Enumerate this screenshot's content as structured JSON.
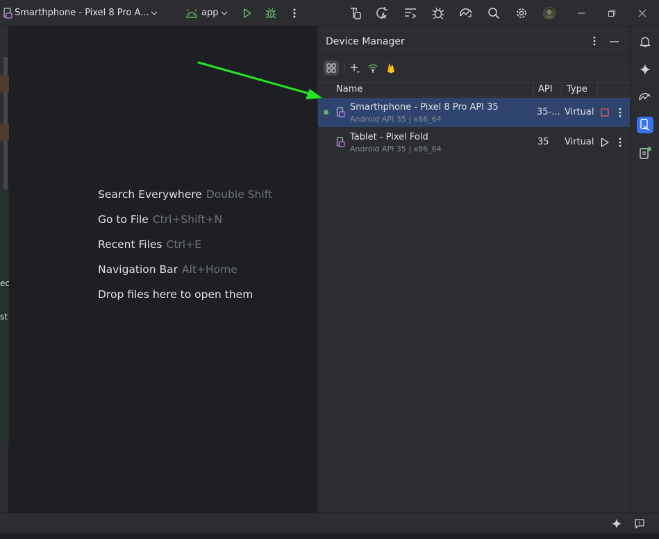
{
  "toolbar": {
    "device_selector": "Smarthphone - Pixel 8 Pro A...",
    "run_config": "app"
  },
  "editor": {
    "hints": [
      {
        "label": "Search Everywhere",
        "key": "Double Shift"
      },
      {
        "label": "Go to File",
        "key": "Ctrl+Shift+N"
      },
      {
        "label": "Recent Files",
        "key": "Ctrl+E"
      },
      {
        "label": "Navigation Bar",
        "key": "Alt+Home"
      },
      {
        "label": "Drop files here to open them",
        "key": ""
      }
    ],
    "left_cut_text": [
      "ec",
      "st"
    ]
  },
  "device_manager": {
    "title": "Device Manager",
    "columns": {
      "name": "Name",
      "api": "API",
      "type": "Type"
    },
    "devices": [
      {
        "name": "Smarthphone - Pixel 8 Pro API 35",
        "details": "Android API 35 | x86_64",
        "api": "35-...",
        "type": "Virtual",
        "running": true
      },
      {
        "name": "Tablet - Pixel Fold",
        "details": "Android API 35 | x86_64",
        "api": "35",
        "type": "Virtual",
        "running": false
      }
    ]
  },
  "colors": {
    "accent": "#3574f0",
    "selection": "#2e436e",
    "running": "#5fb865",
    "stop": "#db5c5c",
    "annotation_arrow": "#22e622",
    "firebase": "#f0a30a"
  },
  "icons": [
    "device-icon",
    "chevron-down-icon",
    "android-icon",
    "run-icon",
    "debug-icon",
    "more-icon",
    "search-icon",
    "gear-icon",
    "minimize-icon",
    "restore-icon",
    "close-icon",
    "bell-icon",
    "sparkle-icon",
    "device-manager-icon",
    "stop-icon",
    "play-icon"
  ]
}
